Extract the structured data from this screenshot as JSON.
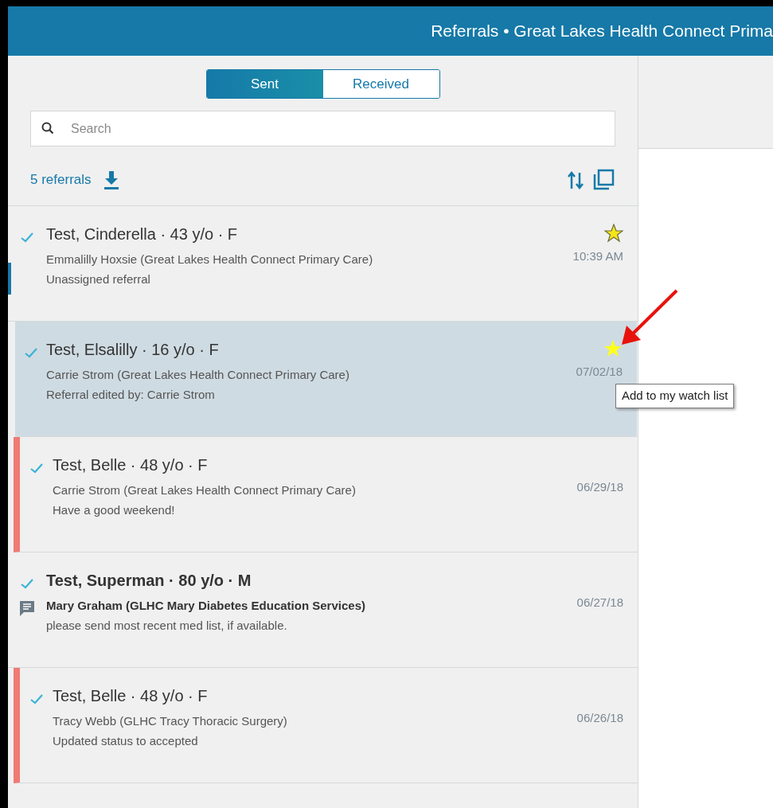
{
  "header": {
    "title": "Referrals • Great Lakes Health Connect Prima"
  },
  "tabs": [
    {
      "label": "Sent",
      "selected": true
    },
    {
      "label": "Received",
      "selected": false
    }
  ],
  "search": {
    "placeholder": "Search"
  },
  "summary": {
    "count": "5 referrals"
  },
  "referrals": [
    {
      "name": "Test, Cinderella · 43 y/o · F",
      "sender": "Emmalilly Hoxsie (Great Lakes Health Connect Primary Care)",
      "note": "Unassigned referral",
      "time": "10:39 AM",
      "starred": true,
      "star_hovered": false,
      "selected": false,
      "flagged": false,
      "unread": false,
      "has_message": false
    },
    {
      "name": "Test, Elsalilly · 16 y/o · F",
      "sender": "Carrie Strom (Great Lakes Health Connect Primary Care)",
      "note": "Referral edited by: Carrie Strom",
      "time": "07/02/18",
      "starred": false,
      "star_hovered": true,
      "tooltip": "Add to my watch list",
      "selected": true,
      "flagged": false,
      "unread": false,
      "has_message": false
    },
    {
      "name": "Test, Belle · 48 y/o · F",
      "sender": "Carrie Strom (Great Lakes Health Connect Primary Care)",
      "note": "Have a good weekend!",
      "time": "06/29/18",
      "starred": false,
      "star_hovered": false,
      "selected": false,
      "flagged": true,
      "unread": false,
      "has_message": false
    },
    {
      "name": "Test, Superman · 80 y/o · M",
      "sender": "Mary Graham (GLHC Mary Diabetes Education Services)",
      "note": "please send most recent med list, if available.",
      "time": "06/27/18",
      "starred": false,
      "star_hovered": false,
      "selected": false,
      "flagged": false,
      "unread": true,
      "has_message": true
    },
    {
      "name": "Test, Belle · 48 y/o · F",
      "sender": "Tracy Webb (GLHC Tracy Thoracic Surgery)",
      "note": "Updated status to accepted",
      "time": "06/26/18",
      "starred": false,
      "star_hovered": false,
      "selected": false,
      "flagged": true,
      "unread": false,
      "has_message": false
    }
  ]
}
